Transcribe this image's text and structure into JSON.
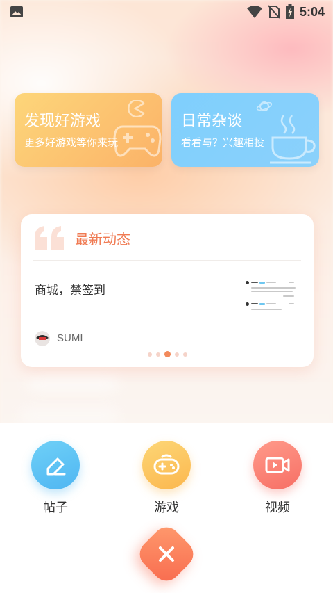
{
  "status_bar": {
    "time": "5:04"
  },
  "categories": [
    {
      "title": "发现好游戏",
      "subtitle": "更多好游戏等你来玩"
    },
    {
      "title": "日常杂谈",
      "subtitle": "看看与？兴趣相投"
    }
  ],
  "news": {
    "heading": "最新动态",
    "text": "商城，禁签到",
    "author": "SUMI",
    "page_dots": 5,
    "active_dot": 2
  },
  "actions": [
    {
      "label": "帖子",
      "icon": "edit-icon"
    },
    {
      "label": "游戏",
      "icon": "gamepad-icon"
    },
    {
      "label": "视频",
      "icon": "video-icon"
    }
  ],
  "close_button": {
    "icon": "close-icon"
  },
  "colors": {
    "accent": "#f07a52",
    "game_card": "#fbb268",
    "talk_card": "#7fcffd",
    "post": "#4fb6f2",
    "game": "#fbb74e",
    "video": "#f76f65"
  }
}
